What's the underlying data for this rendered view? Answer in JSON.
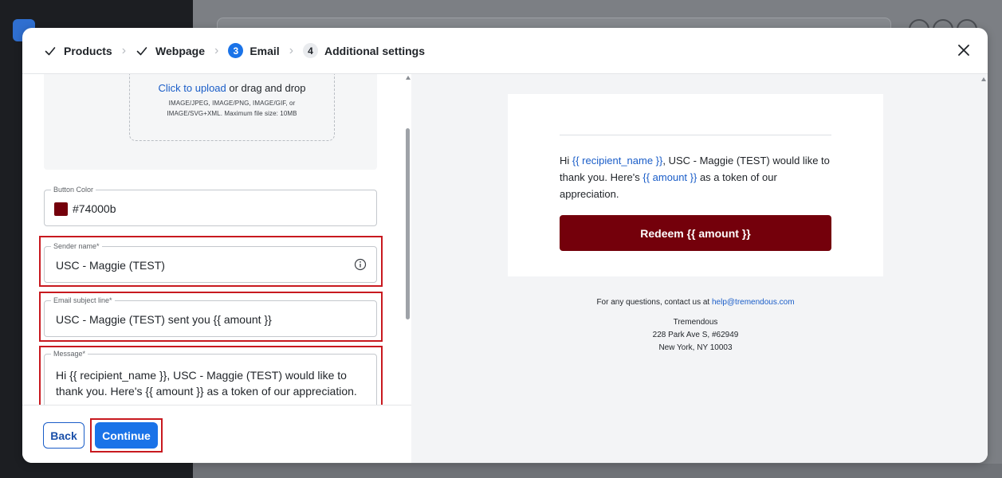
{
  "stepper": {
    "steps": [
      {
        "label": "Products",
        "state": "done"
      },
      {
        "label": "Webpage",
        "state": "done"
      },
      {
        "label": "Email",
        "number": "3",
        "state": "active"
      },
      {
        "label": "Additional settings",
        "number": "4",
        "state": "todo"
      }
    ]
  },
  "upload": {
    "link_text": "Click to upload",
    "rest_text": " or drag and drop",
    "hint_line1": "IMAGE/JPEG, IMAGE/PNG, IMAGE/GIF, or",
    "hint_line2": "IMAGE/SVG+XML. Maximum file size: 10MB"
  },
  "form": {
    "button_color": {
      "label": "Button Color",
      "value": "#74000b"
    },
    "sender_name": {
      "label": "Sender name*",
      "value": "USC - Maggie (TEST)"
    },
    "subject": {
      "label": "Email subject line*",
      "value": "USC - Maggie (TEST) sent you {{ amount }}"
    },
    "message": {
      "label": "Message*",
      "value": "Hi {{ recipient_name }}, USC - Maggie (TEST) would like to thank you. Here's {{ amount }} as a token of our appreciation."
    }
  },
  "footer": {
    "back_label": "Back",
    "continue_label": "Continue"
  },
  "preview": {
    "greeting_prefix": "Hi ",
    "recipient_var": "{{ recipient_name }}",
    "text_mid": ", USC - Maggie (TEST) would like to thank you. Here's ",
    "amount_var": "{{ amount }}",
    "text_end": " as a token of our appreciation.",
    "redeem_label": "Redeem {{ amount }}",
    "contact_prefix": "For any questions, contact us at ",
    "contact_email": "help@tremendous.com",
    "company": "Tremendous",
    "address1": "228 Park Ave S, #62949",
    "address2": "New York, NY 10003"
  },
  "colors": {
    "brand_button": "#74000b",
    "primary": "#1a73e8",
    "highlight": "#c8191f"
  }
}
